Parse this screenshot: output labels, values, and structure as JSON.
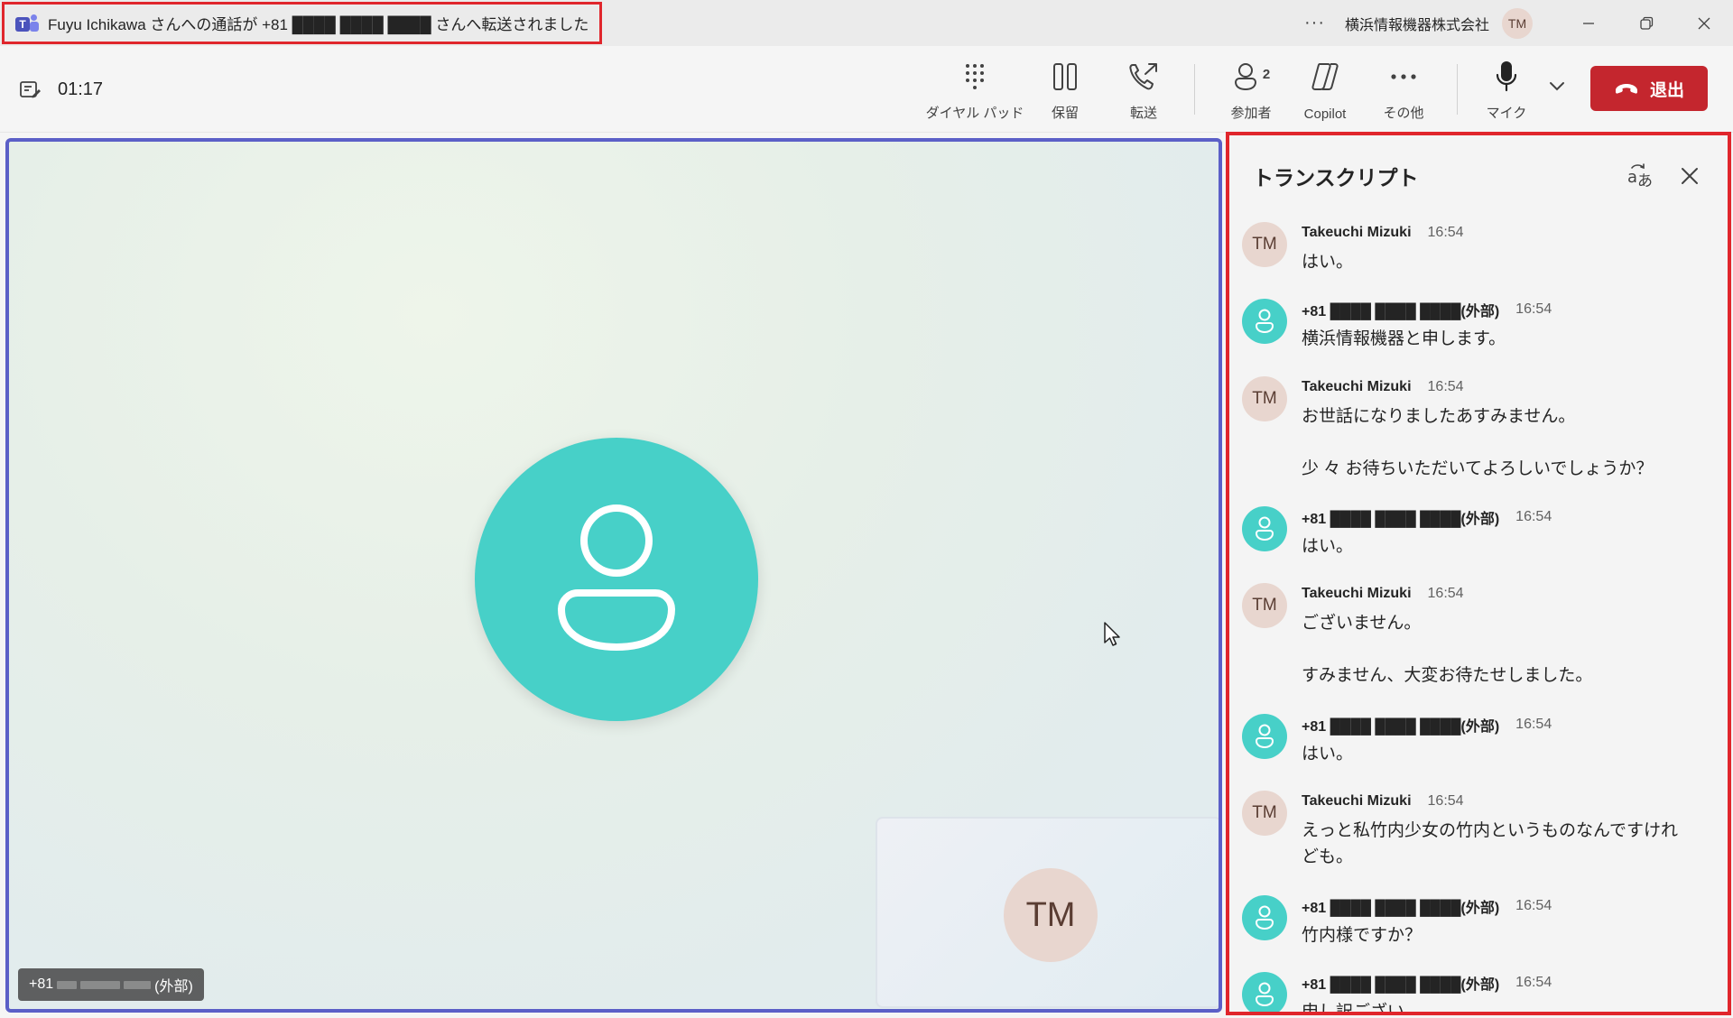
{
  "titlebar": {
    "title": "Fuyu Ichikawa さんへの通話が +81 ████ ████ ████ さんへ転送されました",
    "more": "···",
    "org": "横浜情報機器株式会社",
    "avatar_initials": "TM",
    "icons": [
      "teams-logo",
      "more-icon",
      "minimize-icon",
      "restore-icon",
      "close-icon"
    ]
  },
  "toolbar": {
    "timer": "01:17",
    "dialpad": "ダイヤル パッド",
    "hold": "保留",
    "transfer": "転送",
    "participants": "参加者",
    "participants_count": "2",
    "copilot": "Copilot",
    "more": "その他",
    "mic": "マイク",
    "leave": "退出"
  },
  "stage": {
    "name_tag_prefix": "+81",
    "name_tag_suffix": "(外部)",
    "self_initials": "TM"
  },
  "transcript": {
    "title": "トランスクリプト",
    "messages": [
      {
        "who": "Takeuchi Mizuki",
        "time": "16:54",
        "text": "はい。",
        "kind": "tm"
      },
      {
        "who": "+81 ████ ████ ████(外部)",
        "time": "16:54",
        "text": "横浜情報機器と申します。",
        "kind": "ext"
      },
      {
        "who": "Takeuchi Mizuki",
        "time": "16:54",
        "text": "お世話になりましたあすみません。",
        "text2": "少 々 お待ちいただいてよろしいでしょうか？",
        "kind": "tm"
      },
      {
        "who": "+81 ████ ████ ████(外部)",
        "time": "16:54",
        "text": "はい。",
        "kind": "ext"
      },
      {
        "who": "Takeuchi Mizuki",
        "time": "16:54",
        "text": "ございません。",
        "text2": "すみません、大変お待たせしました。",
        "kind": "tm"
      },
      {
        "who": "+81 ████ ████ ████(外部)",
        "time": "16:54",
        "text": "はい。",
        "kind": "ext"
      },
      {
        "who": "Takeuchi Mizuki",
        "time": "16:54",
        "text": "えっと私竹内少女の竹内というものなんですけれども。",
        "kind": "tm"
      },
      {
        "who": "+81 ████ ████ ████(外部)",
        "time": "16:54",
        "text": "竹内様ですか？",
        "kind": "ext"
      },
      {
        "who": "+81 ████ ████ ████(外部)",
        "time": "16:54",
        "text": "申し訳ござい",
        "kind": "ext"
      }
    ]
  },
  "colors": {
    "accent": "#5b5fc7",
    "leave": "#c4262e",
    "highlight": "#e0262c",
    "avatar_teal": "#47d0c8",
    "avatar_tm": "#e8d6cf"
  }
}
